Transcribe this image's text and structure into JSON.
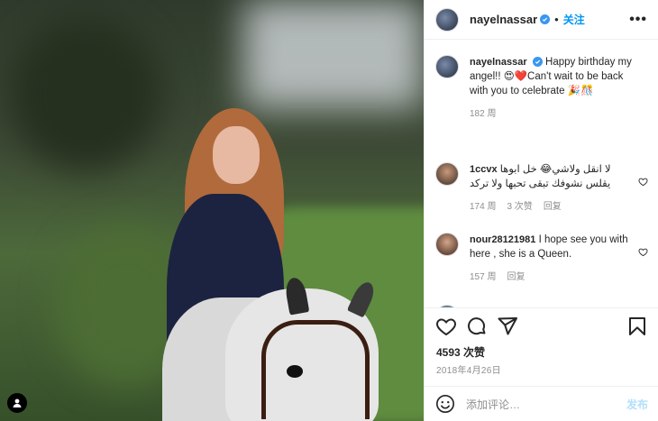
{
  "post": {
    "username": "nayelnassar",
    "follow_label": "关注",
    "separator": "•",
    "more_label": "•••",
    "caption_text": "Happy birthday my angel!! 😍❤️Can't wait to be back with you to celebrate 🎉🎊",
    "caption_time": "182 周"
  },
  "comments": [
    {
      "username": "1ccvx",
      "text": "لا انقل ولاشي😂 خل ابوها يقلس نشوفك تبقى تحبها ولا تركد",
      "time": "174 周",
      "likes": "3 次赞",
      "reply": "回复"
    },
    {
      "username": "nour28121981",
      "text": "I hope see you with here , she is a Queen.",
      "time": "157 周",
      "reply": "回复"
    }
  ],
  "footer": {
    "likes_count": "4593 次赞",
    "date": "2018年4月26日",
    "comment_placeholder": "添加评论…",
    "post_label": "发布"
  },
  "colors": {
    "accent": "#0095f6",
    "verified": "#3897f0",
    "muted": "#8e8e8e",
    "post_disabled": "#b2dffc"
  },
  "icons": [
    "verified-badge-icon",
    "heart-icon",
    "comment-icon",
    "share-icon",
    "bookmark-icon",
    "emoji-icon",
    "user-tag-icon"
  ]
}
